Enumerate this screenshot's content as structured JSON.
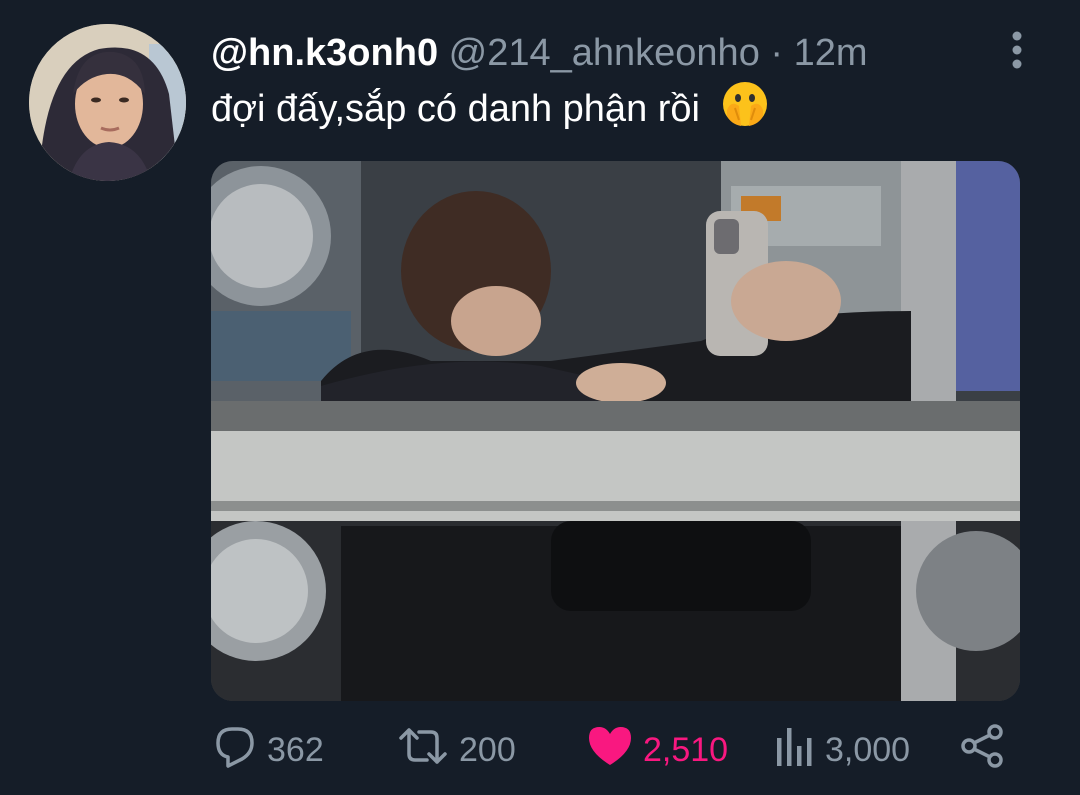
{
  "tweet": {
    "display_name": "@hn.k3onh0",
    "handle": "@214_ahnkeonho",
    "separator": "·",
    "time": "12m",
    "text": "đợi đấy,sắp có danh phận rồi",
    "emoji": "face-with-hand-over-mouth-emoji"
  },
  "actions": {
    "reply_count": "362",
    "retweet_count": "200",
    "like_count": "2,510",
    "views_count": "3,000"
  },
  "colors": {
    "background": "#151d28",
    "text_primary": "#ffffff",
    "text_secondary": "#8b98a5",
    "like": "#f91880"
  },
  "icons": [
    "more-vertical-icon",
    "reply-icon",
    "retweet-icon",
    "heart-icon",
    "views-icon",
    "share-icon"
  ]
}
